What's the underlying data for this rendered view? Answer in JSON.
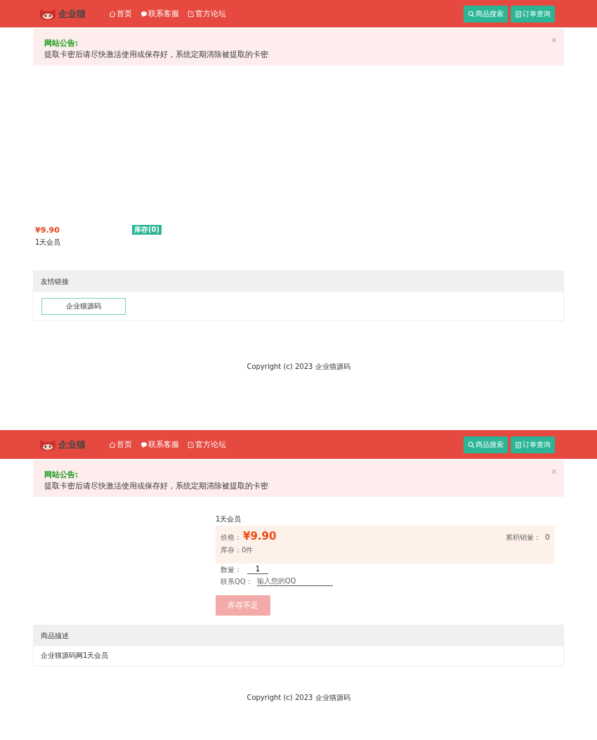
{
  "screens": [
    {
      "kind": "list",
      "header": {
        "logo": {
          "name": "企业猫"
        },
        "nav": [
          {
            "label": "首页"
          },
          {
            "label": "联系客服"
          },
          {
            "label": "官方论坛"
          }
        ],
        "buttons": [
          {
            "label": "商品搜索"
          },
          {
            "label": "订单查询"
          }
        ]
      },
      "notice": {
        "title": "网站公告:",
        "text": "提取卡密后请尽快激活使用或保存好，系统定期清除被提取的卡密",
        "close": "×"
      },
      "products": [
        {
          "price": "¥9.90",
          "name": "1天会员",
          "stock": "库存(0)"
        }
      ],
      "links_panel": {
        "title": "友情链接",
        "links": [
          "企业猫源码"
        ]
      },
      "footer": "Copyright (c) 2023 企业猫源码"
    },
    {
      "kind": "detail",
      "header": {
        "logo": {
          "name": "企业猫"
        },
        "nav": [
          {
            "label": "首页"
          },
          {
            "label": "联系客服"
          },
          {
            "label": "官方论坛"
          }
        ],
        "buttons": [
          {
            "label": "商品搜索"
          },
          {
            "label": "订单查询"
          }
        ]
      },
      "notice": {
        "title": "网站公告:",
        "text": "提取卡密后请尽快激活使用或保存好，系统定期清除被提取的卡密",
        "close": "×"
      },
      "product": {
        "name": "1天会员",
        "price_label": "价格：",
        "price": "¥9.90",
        "sales_label": "累积销量：",
        "sales": "0",
        "stock_label": "库存：",
        "stock": "0件",
        "qty_label": "数量：",
        "qty": "1",
        "qq_label": "联系QQ：",
        "qq_placeholder": "输入您的QQ",
        "buy_button": {
          "label": "库存不足",
          "disabled": true
        }
      },
      "description": {
        "title": "商品描述",
        "text": "企业猫源码网1天会员"
      },
      "footer": "Copyright (c) 2023 企业猫源码"
    }
  ]
}
